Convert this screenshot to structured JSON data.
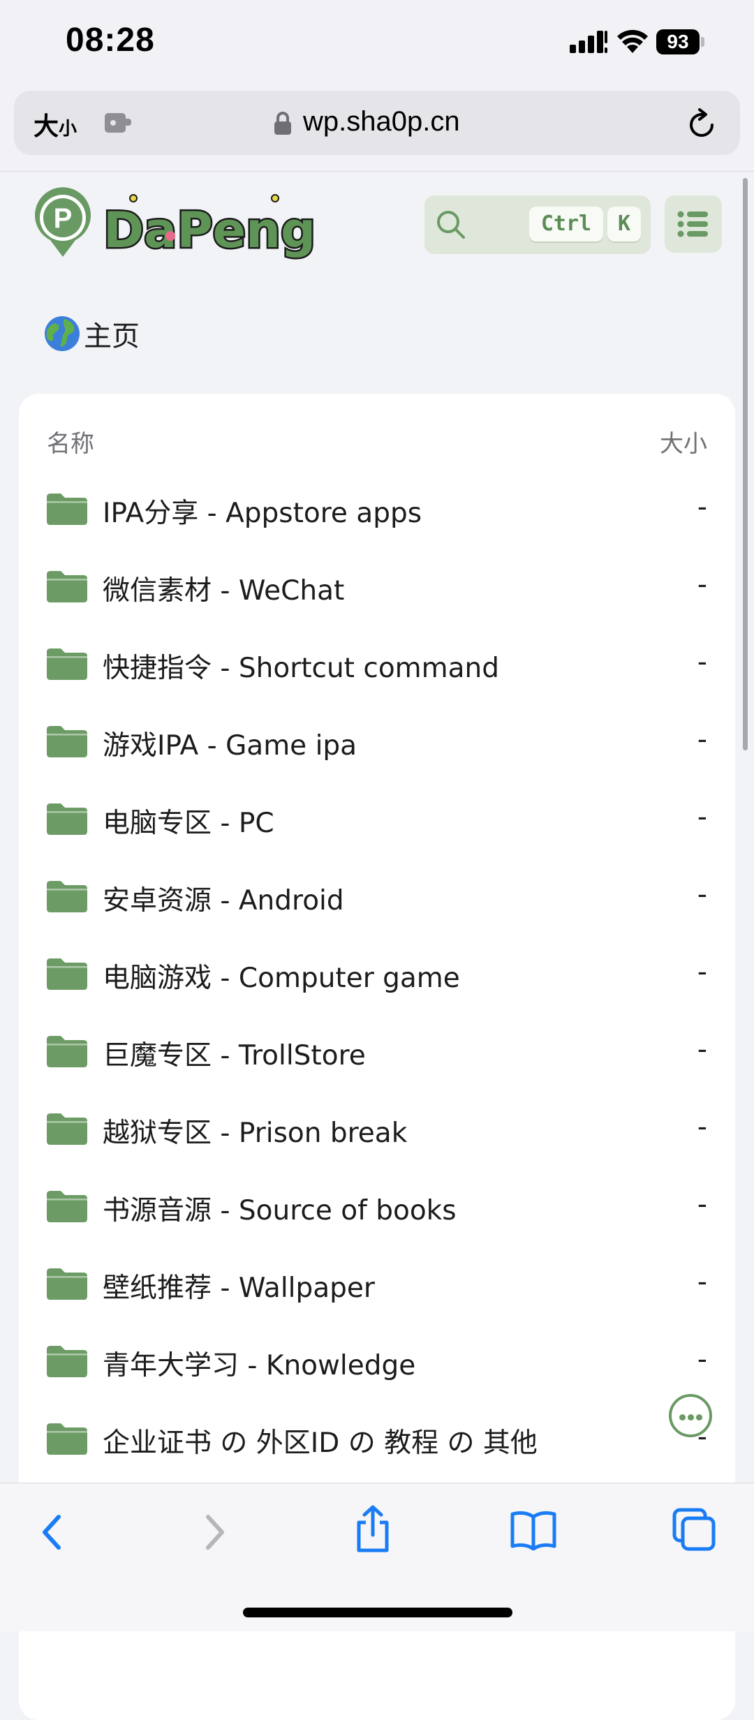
{
  "status_bar": {
    "time": "08:28",
    "battery": "93"
  },
  "browser": {
    "text_size_big": "大",
    "text_size_small": "小",
    "url": "wp.sha0p.cn"
  },
  "header": {
    "logo_text": "DaPeng",
    "logo_letter": "P",
    "shortcut_ctrl": "Ctrl",
    "shortcut_k": "K"
  },
  "breadcrumb": {
    "label": "主页"
  },
  "file_list": {
    "col_name": "名称",
    "col_size": "大小",
    "rows": [
      {
        "name": "IPA分享 - Appstore apps",
        "size": "-"
      },
      {
        "name": "微信素材 - WeChat",
        "size": "-"
      },
      {
        "name": "快捷指令 - Shortcut command",
        "size": "-"
      },
      {
        "name": "游戏IPA - Game ipa",
        "size": "-"
      },
      {
        "name": "电脑专区 - PC",
        "size": "-"
      },
      {
        "name": "安卓资源 - Android",
        "size": "-"
      },
      {
        "name": "电脑游戏 - Computer game",
        "size": "-"
      },
      {
        "name": "巨魔专区 - TrollStore",
        "size": "-"
      },
      {
        "name": "越狱专区 - Prison break",
        "size": "-"
      },
      {
        "name": "书源音源 - Source of books",
        "size": "-"
      },
      {
        "name": "壁纸推荐 - Wallpaper",
        "size": "-"
      },
      {
        "name": "青年大学习 - Knowledge",
        "size": "-"
      },
      {
        "name": "企业证书 の 外区ID の 教程 の 其他",
        "size": "-"
      }
    ]
  },
  "colors": {
    "accent_green": "#6a9a63",
    "folder_green": "#6c9b65",
    "ios_blue": "#1a7cf4"
  }
}
